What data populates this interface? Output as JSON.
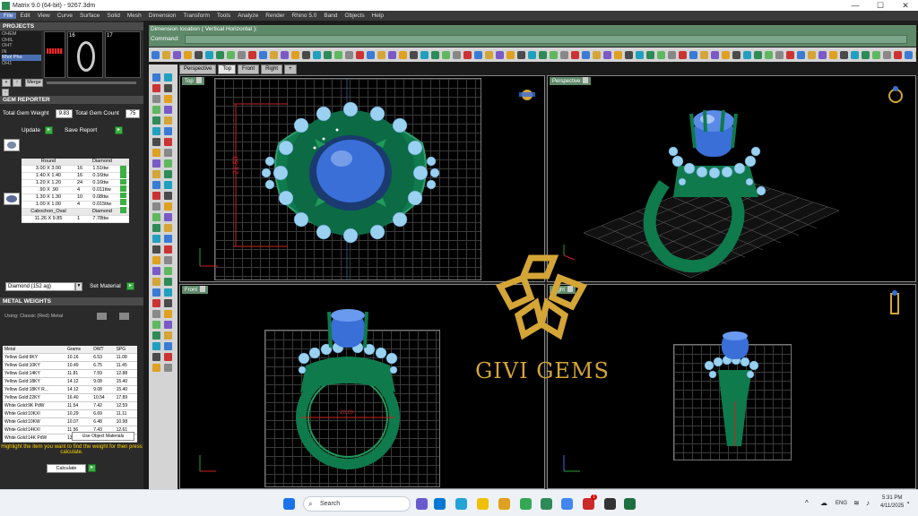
{
  "window": {
    "title": "Matrix 9.0 (64-bit) - 9267.3dm",
    "minimize": "—",
    "maximize": "☐",
    "close": "✕"
  },
  "menu": [
    "File",
    "Edit",
    "View",
    "Curve",
    "Surface",
    "Solid",
    "Mesh",
    "Dimension",
    "Transform",
    "Tools",
    "Analyze",
    "Render",
    "Rhino 5.0",
    "Band",
    "Objects",
    "Help"
  ],
  "projects": {
    "header": "PROJECTS",
    "items": [
      "OHEM",
      "OHIL",
      "OHT",
      "IN",
      "Rhol Pho",
      "OH1"
    ],
    "selected_index": 4,
    "thumb_numbers": [
      "16",
      "17"
    ],
    "nav_buttons": [
      "+",
      "↑",
      "Merge",
      "-"
    ]
  },
  "gem_reporter": {
    "header": "GEM REPORTER",
    "total_weight_label": "Total Gem Weight",
    "total_weight": "9.83",
    "total_count_label": "Total Gem Count",
    "total_count": "75",
    "update_label": "Update",
    "save_label": "Save Report",
    "groups": [
      {
        "shape": "Round",
        "material": "Diamond",
        "rows": [
          [
            "3.00 X 3.00",
            "16",
            "1.51ttw"
          ],
          [
            "1.40 X 1.40",
            "16",
            "0.16ttw"
          ],
          [
            "1.20 X 1.20",
            "24",
            "0.16ttw"
          ],
          [
            ".90 X .90",
            "4",
            "0.011ttw"
          ],
          [
            "1.30 X 1.30",
            "10",
            "0.08ttw"
          ],
          [
            "1.00 X 1.00",
            "4",
            "0.015ttw"
          ]
        ]
      },
      {
        "shape": "Cabochon_Oval",
        "material": "Diamond",
        "rows": [
          [
            "11.26 X 9.85",
            "1",
            "7.78ttw"
          ]
        ]
      }
    ],
    "material_select": "Diamond  (152 ag)",
    "set_material_label": "Set Material"
  },
  "metal_weights": {
    "header": "METAL WEIGHTS",
    "subheader": "Using: Classic  (Red) Metal",
    "columns": [
      "Metal",
      "Grams",
      "DWT",
      "SPG"
    ],
    "rows": [
      [
        "Yellow Gold:9KY",
        "10.16",
        "6.53",
        "11.08"
      ],
      [
        "Yellow Gold:10KY",
        "10.49",
        "6.75",
        "11.45"
      ],
      [
        "Yellow Gold:14KY",
        "11.81",
        "7.59",
        "12.88"
      ],
      [
        "Yellow Gold:18KY",
        "14.12",
        "9.08",
        "15.40"
      ],
      [
        "Yellow Gold:18KY R...",
        "14.12",
        "9.08",
        "15.40"
      ],
      [
        "Yellow Gold:22KY",
        "16.40",
        "10.54",
        "17.89"
      ],
      [
        "White Gold:9K PdW",
        "11.54",
        "7.42",
        "12.59"
      ],
      [
        "White Gold:10KXI",
        "10.29",
        "6.69",
        "11.11"
      ],
      [
        "White Gold:10KW",
        "10.07",
        "6.48",
        "10.98"
      ],
      [
        "White Gold:14KXI",
        "11.56",
        "7.43",
        "12.61"
      ],
      [
        "White Gold:14K PdW",
        "13.17",
        "8.47",
        "14.37"
      ]
    ],
    "use_object_materials": "Use Object Materials",
    "hint": "Highlight the item you want to find the weight for then press calculate.",
    "calculate_label": "Calculate"
  },
  "command": {
    "dimension_prompt": "Dimension location ( Vertical  Horizontal ):",
    "command_label": "Command:"
  },
  "view_tabs": [
    "Perspective",
    "Top",
    "Front",
    "Right",
    "+"
  ],
  "viewports": {
    "top": {
      "label": "Top",
      "dimension": "21.59"
    },
    "perspective": {
      "label": "Perspective"
    },
    "front": {
      "label": "Front",
      "dimension": "20.20"
    },
    "right": {
      "label": "Right"
    }
  },
  "watermark": "GIVI GEMS",
  "taskbar": {
    "search_placeholder": "Search",
    "lang": "ENG",
    "time": "5:31 PM",
    "date": "4/11/2025",
    "notification": "1"
  },
  "colors": {
    "accent_green": "#5f8a6a",
    "ring_green": "#0f7a4c",
    "gem_blue": "#3a6fd8",
    "pave_blue": "#9ad0f0",
    "gold": "#d4a537",
    "dim_red": "#d02020"
  }
}
